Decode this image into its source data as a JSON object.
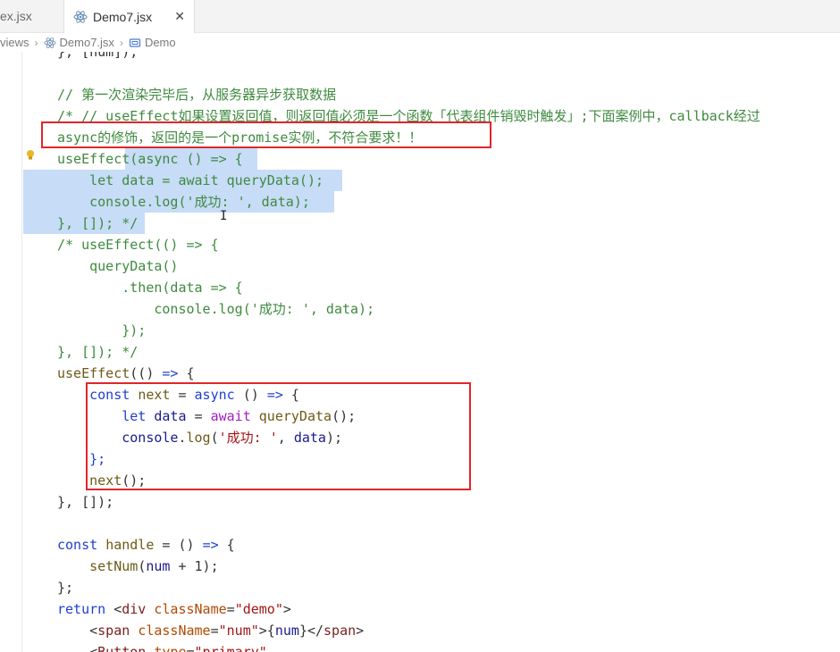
{
  "tabs": [
    {
      "label": "ex.jsx",
      "active": false
    },
    {
      "label": "Demo7.jsx",
      "active": true,
      "close": "✕"
    }
  ],
  "breadcrumb": {
    "items": [
      "views",
      "Demo7.jsx",
      "Demo"
    ]
  },
  "editor": {
    "lines": [
      {
        "id": "l0",
        "html": "<span class='pn'>}, [num]);</span>"
      },
      {
        "id": "l1",
        "html": ""
      },
      {
        "id": "l2",
        "html": "<span class='c'>// 第一次渲染完毕后，从服务器异步获取数据</span>"
      },
      {
        "id": "l3",
        "html": "<span class='c'>/* // useEffect如果设置返回值，则返回值必须是一个函数「代表组件销毁时触发」;下面案例中，callback经过</span>"
      },
      {
        "id": "l4",
        "html": "<span class='c'>async的修饰，返回的是一个promise实例，不符合要求！！</span>"
      },
      {
        "id": "l5",
        "html": "<span class='c'>useEffect(async () =&gt; {</span>"
      },
      {
        "id": "l6",
        "html": "<span class='c'>    let data = await queryData();</span>"
      },
      {
        "id": "l7",
        "html": "<span class='c'>    console.log('成功: ', data);</span>"
      },
      {
        "id": "l8",
        "html": "<span class='c'>}, []); */</span>"
      },
      {
        "id": "l9",
        "html": "<span class='c'>/* useEffect(() =&gt; {</span>"
      },
      {
        "id": "l10",
        "html": "<span class='c'>    queryData()</span>"
      },
      {
        "id": "l11",
        "html": "<span class='c'>        .then(data =&gt; {</span>"
      },
      {
        "id": "l12",
        "html": "<span class='c'>            console.log('成功: ', data);</span>"
      },
      {
        "id": "l13",
        "html": "<span class='c'>        });</span>"
      },
      {
        "id": "l14",
        "html": "<span class='c'>}, []); */</span>"
      },
      {
        "id": "l15",
        "html": "<span class='fn'>useEffect</span><span class='pn'>(() </span><span class='kw'>=&gt;</span><span class='pn'> {</span>"
      },
      {
        "id": "l16",
        "html": "<span class='pn'>    </span><span class='kw'>const</span><span class='pn'> </span><span class='fn'>next</span><span class='pn'> = </span><span class='kw'>async</span><span class='pn'> () </span><span class='kw'>=&gt;</span><span class='pn'> {</span>"
      },
      {
        "id": "l17",
        "html": "<span class='pn'>        </span><span class='kw'>let</span><span class='pn'> </span><span class='var'>data</span><span class='pn'> = </span><span class='kw2'>await</span><span class='pn'> </span><span class='fn'>queryData</span><span class='pn'>();</span>"
      },
      {
        "id": "l18",
        "html": "<span class='pn'>        </span><span class='var'>console</span><span class='pn'>.</span><span class='fn'>log</span><span class='pn'>(</span><span class='str'>'成功: '</span><span class='pn'>, </span><span class='var'>data</span><span class='pn'>);</span>"
      },
      {
        "id": "l19",
        "html": "<span class='pn'>    </span><span class='kw'>};</span>"
      },
      {
        "id": "l20",
        "html": "<span class='pn'>    </span><span class='fn'>next</span><span class='pn'>();</span>"
      },
      {
        "id": "l21",
        "html": "<span class='pn'>}, []);</span>"
      },
      {
        "id": "l22",
        "html": ""
      },
      {
        "id": "l23",
        "html": "<span class='kw'>const</span><span class='pn'> </span><span class='fn'>handle</span><span class='pn'> = () </span><span class='kw'>=&gt;</span><span class='pn'> {</span>"
      },
      {
        "id": "l24",
        "html": "<span class='pn'>    </span><span class='fn'>setNum</span><span class='pn'>(</span><span class='var'>num</span><span class='pn'> + 1);</span>"
      },
      {
        "id": "l25",
        "html": "<span class='pn'>};</span>"
      },
      {
        "id": "l26",
        "html": "<span class='kw'>return</span><span class='pn'> &lt;</span><span class='tag'>div</span><span class='pn'> </span><span class='attr'>className</span><span class='pn'>=</span><span class='str'>\"demo\"</span><span class='pn'>&gt;</span>"
      },
      {
        "id": "l27",
        "html": "<span class='pn'>    &lt;</span><span class='tag'>span</span><span class='pn'> </span><span class='attr'>className</span><span class='pn'>=</span><span class='str'>\"num\"</span><span class='pn'>&gt;{</span><span class='var'>num</span><span class='pn'>}&lt;/</span><span class='tag'>span</span><span class='pn'>&gt;</span>"
      },
      {
        "id": "l28",
        "html": "<span class='pn'>    &lt;</span><span class='tag'>Button</span><span class='pn'> </span><span class='attr'>type</span><span class='pn'>=</span><span class='str'>\"primary\"</span>"
      }
    ]
  },
  "colors": {
    "selection": "#c7dcf7",
    "annotation_box": "#e0262b",
    "comment": "#3f8a3f",
    "keyword": "#1f3fd0"
  }
}
